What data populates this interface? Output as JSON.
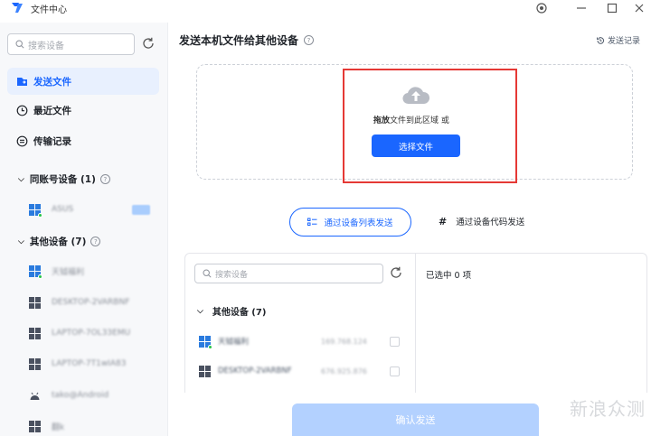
{
  "window": {
    "title": "文件中心",
    "controls": [
      "target-icon",
      "minimize-icon",
      "maximize-icon",
      "close-icon"
    ]
  },
  "sidebar": {
    "search_placeholder": "搜索设备",
    "nav": [
      {
        "label": "发送文件",
        "icon": "send-file-icon",
        "active": true
      },
      {
        "label": "最近文件",
        "icon": "clock-icon",
        "active": false
      },
      {
        "label": "传输记录",
        "icon": "transfer-icon",
        "active": false
      }
    ],
    "groups": [
      {
        "label": "同账号设备 (1)",
        "devices": [
          {
            "name": "ASUS",
            "os": "windows"
          }
        ]
      },
      {
        "label": "其他设备 (7)",
        "devices": [
          {
            "name": "天钺福利",
            "os": "windows"
          },
          {
            "name": "DESKTOP-2VARBNF",
            "os": "windows"
          },
          {
            "name": "LAPTOP-7OL33EMU",
            "os": "windows"
          },
          {
            "name": "LAPTOP-7T1wIA83",
            "os": "windows"
          },
          {
            "name": "tako@Android",
            "os": "android"
          },
          {
            "name": "翻k",
            "os": "windows"
          }
        ]
      }
    ]
  },
  "main": {
    "title": "发送本机文件给其他设备",
    "history_link": "发送记录",
    "drop_text_bold": "拖放",
    "drop_text": "文件到此区域 或",
    "choose_button": "选择文件",
    "tabs": [
      {
        "label": "通过设备列表发送",
        "active": true
      },
      {
        "label": "通过设备代码发送",
        "active": false
      }
    ],
    "panel": {
      "search_placeholder": "搜索设备",
      "selected_text": "已选中 0 项",
      "group_label": "其他设备 (7)",
      "rows": [
        {
          "name": "天钺福利",
          "ip": "169.768.124"
        },
        {
          "name": "DESKTOP-2VARBNF",
          "ip": "676.925.876"
        }
      ]
    },
    "send_button": "确认发送"
  },
  "watermark": "新浪众测",
  "colors": {
    "accent": "#1a66ff",
    "active_nav_bg": "#e8f0fe",
    "highlight": "#e53935",
    "disabled_button": "#b3d1ff",
    "online": "#27c346"
  }
}
